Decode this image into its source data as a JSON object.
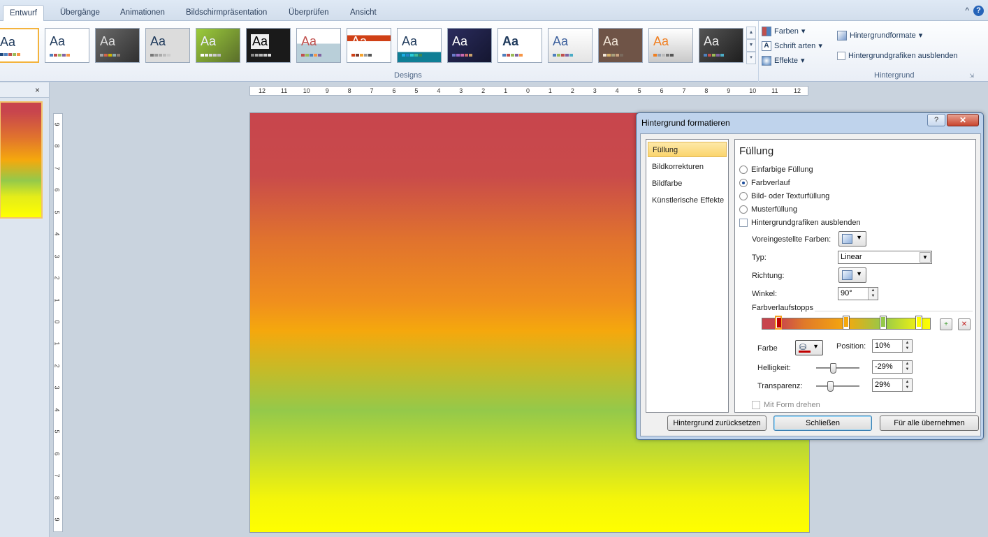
{
  "tabs": [
    "Entwurf",
    "Übergänge",
    "Animationen",
    "Bildschirmpräsentation",
    "Überprüfen",
    "Ansicht"
  ],
  "window_controls": {
    "minimize_ribbon": "^",
    "help": "?"
  },
  "ribbon": {
    "designs_label": "Designs",
    "theme_label": "Aa",
    "options": {
      "colors": "Farben",
      "fonts": "Schrift arten",
      "effects": "Effekte"
    },
    "background": {
      "formats": "Hintergrundformate",
      "hide_graphics": "Hintergrundgrafiken ausblenden",
      "label": "Hintergrund"
    }
  },
  "left_pane": {
    "close": "×"
  },
  "ruler_h": [
    "12",
    "11",
    "10",
    "9",
    "8",
    "7",
    "6",
    "5",
    "4",
    "3",
    "2",
    "1",
    "0",
    "1",
    "2",
    "3",
    "4",
    "5",
    "6",
    "7",
    "8",
    "9",
    "10",
    "11",
    "12"
  ],
  "ruler_v": [
    "9",
    "8",
    "7",
    "6",
    "5",
    "4",
    "3",
    "2",
    "1",
    "0",
    "1",
    "2",
    "3",
    "4",
    "5",
    "6",
    "7",
    "8",
    "9"
  ],
  "dialog": {
    "title": "Hintergrund formatieren",
    "help": "?",
    "close": "✕",
    "nav": [
      "Füllung",
      "Bildkorrekturen",
      "Bildfarbe",
      "Künstlerische Effekte"
    ],
    "section_title": "Füllung",
    "fill_options": [
      "Einfarbige Füllung",
      "Farbverlauf",
      "Bild- oder Texturfüllung",
      "Musterfüllung"
    ],
    "selected_fill": "Farbverlauf",
    "hide_graphics": "Hintergrundgrafiken ausblenden",
    "preset_colors_label": "Voreingestellte Farben:",
    "type_label": "Typ:",
    "type_value": "Linear",
    "direction_label": "Richtung:",
    "angle_label": "Winkel:",
    "angle_value": "90°",
    "stops_label": "Farbverlaufstopps",
    "color_label": "Farbe",
    "position_label": "Position:",
    "position_value": "10%",
    "brightness_label": "Helligkeit:",
    "brightness_value": "-29%",
    "transparency_label": "Transparenz:",
    "transparency_value": "29%",
    "rotate_with_shape": "Mit Form drehen",
    "buttons": {
      "reset": "Hintergrund zurücksetzen",
      "close": "Schließen",
      "apply_all": "Für alle übernehmen"
    }
  },
  "gradient": {
    "stops": [
      {
        "position": 0.1,
        "color": "#c00000"
      },
      {
        "position": 0.5,
        "color": "#f5a80d"
      },
      {
        "position": 0.72,
        "color": "#94c94a"
      },
      {
        "position": 0.93,
        "color": "#ffff00"
      }
    ],
    "brightness_level": -0.29,
    "transparency_level": 0.29
  },
  "colors": {
    "accent_selection": "#f3b33d",
    "slide_top": "#c8454d",
    "slide_bottom": "#ffff00"
  }
}
